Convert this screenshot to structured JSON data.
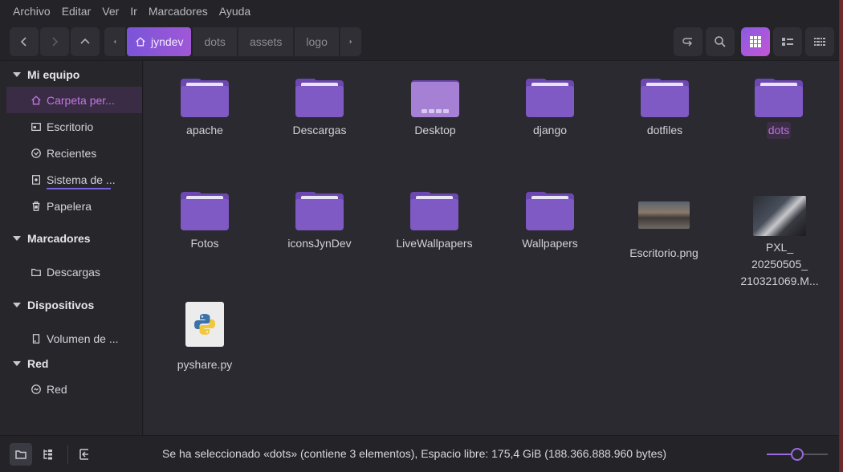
{
  "menubar": {
    "items": [
      "Archivo",
      "Editar",
      "Ver",
      "Ir",
      "Marcadores",
      "Ayuda"
    ]
  },
  "breadcrumb": {
    "items": [
      "jyndev",
      "dots",
      "assets",
      "logo"
    ]
  },
  "sidebar": {
    "sections": [
      {
        "title": "Mi equipo",
        "items": [
          "Carpeta per...",
          "Escritorio",
          "Recientes",
          "Sistema de ...",
          "Papelera"
        ]
      },
      {
        "title": "Marcadores",
        "items": [
          "Descargas"
        ]
      },
      {
        "title": "Dispositivos",
        "items": [
          "Volumen de ..."
        ]
      },
      {
        "title": "Red",
        "items": [
          "Red"
        ]
      }
    ],
    "selected": "Carpeta per..."
  },
  "files": [
    {
      "name": "apache",
      "type": "folder"
    },
    {
      "name": "Descargas",
      "type": "folder"
    },
    {
      "name": "Desktop",
      "type": "desktop-folder"
    },
    {
      "name": "django",
      "type": "folder"
    },
    {
      "name": "dotfiles",
      "type": "folder"
    },
    {
      "name": "dots",
      "type": "folder",
      "selected": true
    },
    {
      "name": "Fotos",
      "type": "folder"
    },
    {
      "name": "iconsJynDev",
      "type": "folder"
    },
    {
      "name": "LiveWallpapers",
      "type": "folder"
    },
    {
      "name": "Wallpapers",
      "type": "folder"
    },
    {
      "name": "Escritorio.png",
      "type": "image"
    },
    {
      "name_lines": [
        "PXL_",
        "20250505_",
        "210321069.M..."
      ],
      "type": "video"
    },
    {
      "name": "pyshare.py",
      "type": "python"
    }
  ],
  "statusbar": {
    "text": "Se ha seleccionado «dots» (contiene 3 elementos), Espacio libre: 175,4 GiB (188.366.888.960 bytes)",
    "zoom_level": 0.5
  },
  "colors": {
    "accent": "#9a6ae0",
    "folder": "#7f59c4",
    "selected_text": "#b674da"
  }
}
